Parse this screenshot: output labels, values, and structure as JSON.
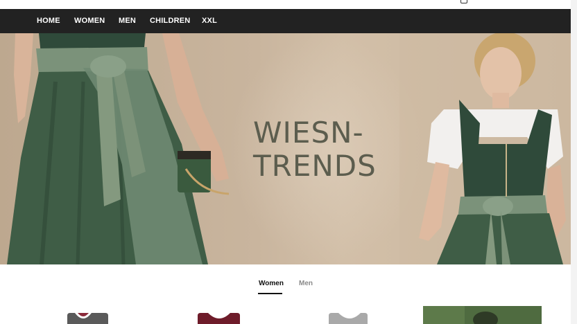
{
  "nav": {
    "items": [
      {
        "label": "HOME"
      },
      {
        "label": "WOMEN"
      },
      {
        "label": "MEN"
      },
      {
        "label": "CHILDREN"
      },
      {
        "label": "XXL"
      }
    ]
  },
  "hero": {
    "line1": "WIESN-",
    "line2": "TRENDS"
  },
  "tabs": [
    {
      "label": "Women",
      "active": true
    },
    {
      "label": "Men",
      "active": false
    }
  ],
  "colors": {
    "nav_background": "#222222",
    "hero_text": "#5c5d4e",
    "dress_green": "#3f5d46"
  },
  "icons": [
    "cart-icon"
  ]
}
